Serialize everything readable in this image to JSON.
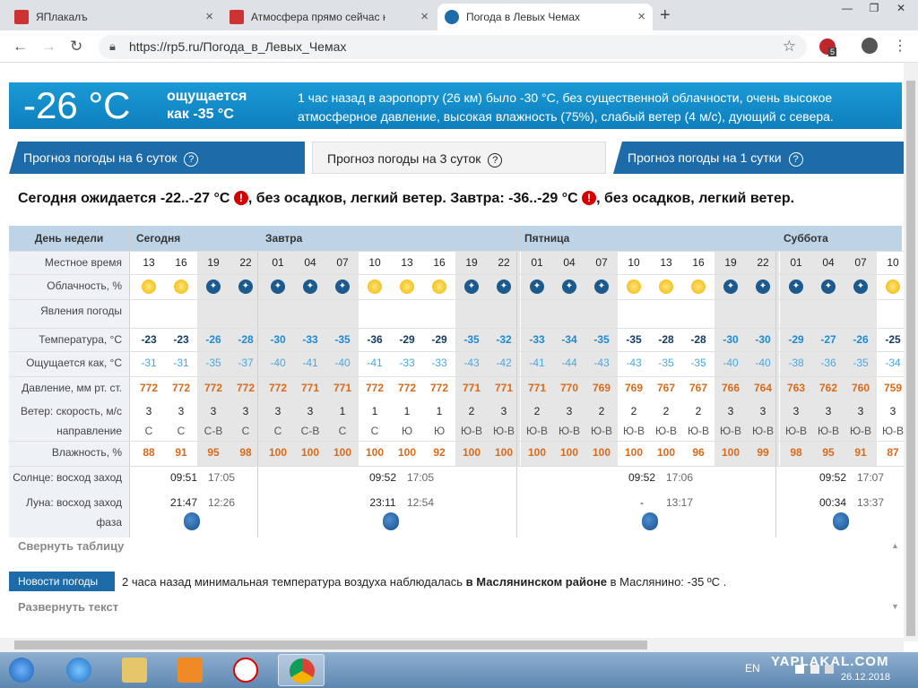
{
  "browser": {
    "tabs": [
      {
        "title": "ЯПлакалъ",
        "active": false
      },
      {
        "title": "Атмосфера прямо сейчас на тр",
        "active": false
      },
      {
        "title": "Погода в Левых Чемах",
        "active": true
      }
    ],
    "new_tab": "+",
    "url": "https://rp5.ru/Погода_в_Левых_Чемах",
    "ext_badge": "5",
    "colors": {
      "tabbar": "#dee1e6",
      "omnibox": "#f1f3f4"
    }
  },
  "current": {
    "temp": "-26 °C",
    "feels_label": "ощущается",
    "feels_value": "как -35 °C",
    "description": "1 час назад в аэропорту (26 км) было -30 °C, без существенной облачности, очень высокое атмосферное давление, высокая влажность (75%), слабый ветер (4 м/с), дующий с севера."
  },
  "forecast_tabs": [
    {
      "label": "Прогноз погоды на 6 суток",
      "help": "?",
      "active": false
    },
    {
      "label": "Прогноз погоды на 3 суток",
      "help": "?",
      "active": true
    },
    {
      "label": "Прогноз погоды на 1 сутки",
      "help": "?",
      "active": false
    }
  ],
  "summary": {
    "part1": "Сегодня ожидается -22..-27 °C",
    "part2": ", без осадков, легкий ветер. Завтра: -36..-29 °C",
    "part3": ", без осадков, легкий ветер.",
    "warn": "!"
  },
  "table": {
    "row_labels": {
      "day": "День недели",
      "time": "Местное время",
      "cloud": "Облачность, %",
      "phen": "Явления погоды",
      "temp": "Температура, °C",
      "feels": "Ощущается как, °C",
      "pressure": "Давление, мм рт. ст.",
      "wind_speed": "Ветер: скорость, м/с",
      "wind_dir": "направление",
      "humidity": "Влажность, %",
      "sun": "Солнце: восход заход",
      "moon": "Луна: восход заход",
      "phase": "фаза"
    },
    "days": [
      {
        "name": "Сегодня",
        "sunrise": "09:51",
        "sunset": "17:05",
        "moonrise": "21:47",
        "moonset": "12:26"
      },
      {
        "name": "Завтра",
        "sunrise": "09:52",
        "sunset": "17:05",
        "moonrise": "23:11",
        "moonset": "12:54"
      },
      {
        "name": "Пятница",
        "sunrise": "09:52",
        "sunset": "17:06",
        "moonrise": "-",
        "moonset": "13:17"
      },
      {
        "name": "Суббота",
        "sunrise": "09:52",
        "sunset": "17:07",
        "moonrise": "00:34",
        "moonset": "13:37"
      }
    ],
    "times": [
      "13",
      "16",
      "19",
      "22",
      "01",
      "04",
      "07",
      "10",
      "13",
      "16",
      "19",
      "22",
      "01",
      "04",
      "07",
      "10",
      "13",
      "16",
      "19",
      "22",
      "01",
      "04",
      "07",
      "10"
    ],
    "cloud_icons": [
      "sun",
      "sun",
      "moon",
      "moon",
      "moon",
      "moon",
      "moon",
      "sun",
      "sun",
      "sun",
      "moon",
      "moon",
      "moon",
      "moon",
      "moon",
      "sun",
      "sun",
      "sun",
      "moon",
      "moon",
      "moon",
      "moon",
      "moon",
      "sun"
    ],
    "temp": [
      "-23",
      "-23",
      "-26",
      "-28",
      "-30",
      "-33",
      "-35",
      "-36",
      "-29",
      "-29",
      "-35",
      "-32",
      "-33",
      "-34",
      "-35",
      "-35",
      "-28",
      "-28",
      "-30",
      "-30",
      "-29",
      "-27",
      "-26",
      "-25"
    ],
    "feels": [
      "-31",
      "-31",
      "-35",
      "-37",
      "-40",
      "-41",
      "-40",
      "-41",
      "-33",
      "-33",
      "-43",
      "-42",
      "-41",
      "-44",
      "-43",
      "-43",
      "-35",
      "-35",
      "-40",
      "-40",
      "-38",
      "-36",
      "-35",
      "-34"
    ],
    "pressure": [
      "772",
      "772",
      "772",
      "772",
      "772",
      "771",
      "771",
      "772",
      "772",
      "772",
      "771",
      "771",
      "771",
      "770",
      "769",
      "769",
      "767",
      "767",
      "766",
      "764",
      "763",
      "762",
      "760",
      "759"
    ],
    "wind_speed": [
      "3",
      "3",
      "3",
      "3",
      "3",
      "3",
      "1",
      "1",
      "1",
      "1",
      "2",
      "3",
      "2",
      "3",
      "2",
      "2",
      "2",
      "2",
      "3",
      "3",
      "3",
      "3",
      "3",
      "3"
    ],
    "wind_dir": [
      "С",
      "С",
      "С-В",
      "С",
      "С",
      "С-В",
      "С",
      "С",
      "Ю",
      "Ю",
      "Ю-В",
      "Ю-В",
      "Ю-В",
      "Ю-В",
      "Ю-В",
      "Ю-В",
      "Ю-В",
      "Ю-В",
      "Ю-В",
      "Ю-В",
      "Ю-В",
      "Ю-В",
      "Ю-В",
      "Ю-В"
    ],
    "humidity": [
      "88",
      "91",
      "95",
      "98",
      "100",
      "100",
      "100",
      "100",
      "100",
      "92",
      "100",
      "100",
      "100",
      "100",
      "100",
      "100",
      "100",
      "96",
      "100",
      "99",
      "98",
      "95",
      "91",
      "87"
    ],
    "colors": {
      "daybar": "#bcd4e6",
      "temp_dark": "#143b62",
      "temp_blue": "#1d8ad6",
      "orange": "#d86a1a"
    }
  },
  "collapse_label": "Свернуть таблицу",
  "news": {
    "label": "Новости погоды",
    "text_before": "2 часа назад минимальная температура воздуха наблюдалась ",
    "text_bold": "в Маслянинском районе",
    "text_after": " в Маслянино: -35 ºС ."
  },
  "expand_label": "Развернуть текст",
  "taskbar": {
    "lang": "EN",
    "date": "26.12.2018",
    "watermark": "YAPLAKAL.COM"
  }
}
